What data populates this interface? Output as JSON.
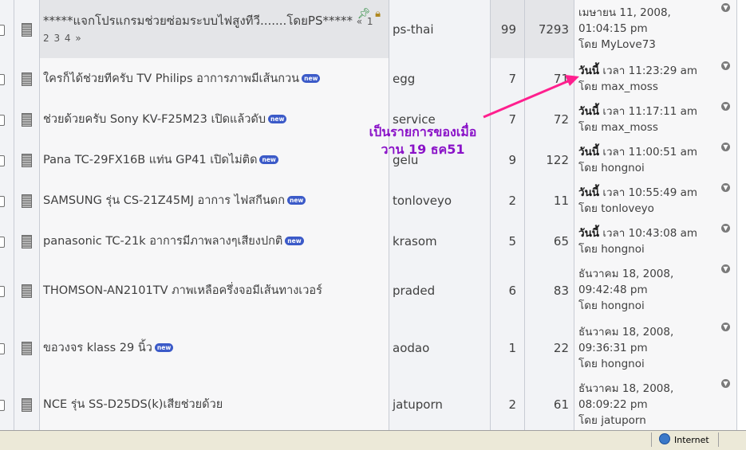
{
  "topics": [
    {
      "title": "*****แจกโปรแกรมช่วยซ่อมระบบไฟสูงทีวี.......โดยPS*****",
      "pages": "« 1 2 3 4 »",
      "is_new": false,
      "sticky": true,
      "starter": "ps-thai",
      "replies": "99",
      "views": "7293",
      "last_line1": "เมษายน 11, 2008,",
      "last_line2": "01:04:15 pm",
      "last_by": "โดย MyLove73"
    },
    {
      "title": "ใครก็ได้ช่วยทีครับ TV Philips อาการภาพมีเส้นกวน",
      "is_new": true,
      "starter": "egg",
      "replies": "7",
      "views": "71",
      "today": "วันนี้",
      "last_line1": " เวลา 11:23:29 am",
      "last_by": "โดย max_moss"
    },
    {
      "title": "ช่วยด้วยครับ Sony KV-F25M23 เปิดแล้วดับ",
      "is_new": true,
      "starter": "service",
      "replies": "7",
      "views": "72",
      "today": "วันนี้",
      "last_line1": " เวลา 11:17:11 am",
      "last_by": "โดย max_moss"
    },
    {
      "title": "Pana TC-29FX16B แท่น GP41 เปิดไม่ติด",
      "is_new": true,
      "starter": "gelu",
      "replies": "9",
      "views": "122",
      "today": "วันนี้",
      "last_line1": " เวลา 11:00:51 am",
      "last_by": "โดย hongnoi"
    },
    {
      "title": "SAMSUNG รุ่น CS-21Z45MJ อาการ ไฟสกีนดก",
      "is_new": true,
      "starter": "tonloveyo",
      "replies": "2",
      "views": "11",
      "today": "วันนี้",
      "last_line1": " เวลา 10:55:49 am",
      "last_by": "โดย tonloveyo"
    },
    {
      "title": "panasonic TC-21k อาการมีภาพลางๆเสียงปกติ",
      "is_new": true,
      "starter": "krasom",
      "replies": "5",
      "views": "65",
      "today": "วันนี้",
      "last_line1": " เวลา 10:43:08 am",
      "last_by": "โดย hongnoi"
    },
    {
      "title": "THOMSON-AN2101TV ภาพเหลือครึ่งจอมีเส้นทางเวอร์",
      "is_new": false,
      "starter": "praded",
      "replies": "6",
      "views": "83",
      "last_line1": "ธันวาคม 18, 2008,",
      "last_line2": "09:42:48 pm",
      "last_by": "โดย hongnoi"
    },
    {
      "title": "ขอวงจร klass 29 นิ้ว",
      "is_new": true,
      "starter": "aodao",
      "replies": "1",
      "views": "22",
      "last_line1": "ธันวาคม 18, 2008,",
      "last_line2": "09:36:31 pm",
      "last_by": "โดย hongnoi"
    },
    {
      "title": "NCE รุ่น SS-D25DS(k)เสียช่วยด้วย",
      "is_new": false,
      "starter": "jatuporn",
      "replies": "2",
      "views": "61",
      "last_line1": "ธันวาคม 18, 2008,",
      "last_line2": "08:09:22 pm",
      "last_by": "โดย jatuporn"
    }
  ],
  "new_badge": "new",
  "annotation": {
    "line1": "เป็นรายการของเมื่อ",
    "line2": "วาน 19 ธค51",
    "color": "#ff1f8e"
  },
  "statusbar": {
    "zone": "Internet"
  },
  "icons": {
    "pin": "pin-icon",
    "lock": "lock-icon",
    "goto": "last-post-icon",
    "doc": "topic-document-icon",
    "globe": "internet-zone-icon"
  }
}
